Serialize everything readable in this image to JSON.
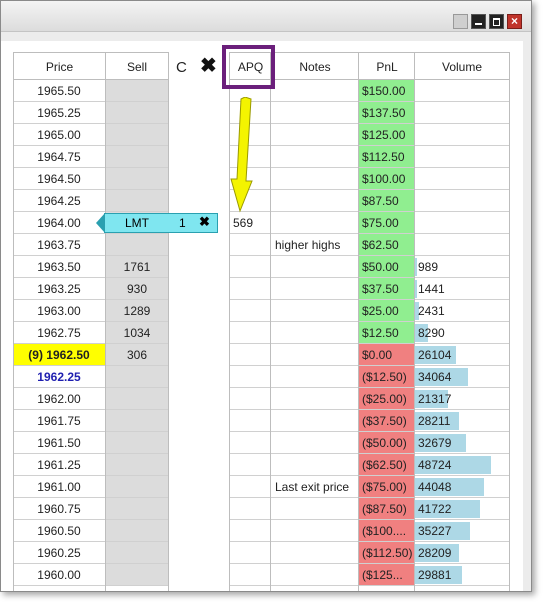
{
  "window": {
    "buttons": {
      "minimize": "minimize",
      "maximize": "maximize",
      "close": "close"
    }
  },
  "header": {
    "price": "Price",
    "sell": "Sell",
    "c": "C",
    "x": "✖",
    "apq": "APQ",
    "notes": "Notes",
    "pnl": "PnL",
    "volume": "Volume"
  },
  "order": {
    "type": "LMT",
    "qty": "1",
    "cancel": "✖"
  },
  "colors": {
    "pnl_positive": "#90ee90",
    "pnl_negative": "#f08080",
    "current_price": "#ffff00",
    "volume_bar": "#add8e6",
    "annotation": "#6b1f7b",
    "arrow": "#f4f400"
  },
  "max_volume": 48724,
  "rows": [
    {
      "price": "1965.50",
      "sell": "",
      "apq": "",
      "notes": "",
      "pnl": "$150.00",
      "pnl_sign": "pos",
      "volume": ""
    },
    {
      "price": "1965.25",
      "sell": "",
      "apq": "",
      "notes": "",
      "pnl": "$137.50",
      "pnl_sign": "pos",
      "volume": ""
    },
    {
      "price": "1965.00",
      "sell": "",
      "apq": "",
      "notes": "",
      "pnl": "$125.00",
      "pnl_sign": "pos",
      "volume": ""
    },
    {
      "price": "1964.75",
      "sell": "",
      "apq": "",
      "notes": "",
      "pnl": "$112.50",
      "pnl_sign": "pos",
      "volume": ""
    },
    {
      "price": "1964.50",
      "sell": "",
      "apq": "",
      "notes": "",
      "pnl": "$100.00",
      "pnl_sign": "pos",
      "volume": ""
    },
    {
      "price": "1964.25",
      "sell": "",
      "apq": "",
      "notes": "",
      "pnl": "$87.50",
      "pnl_sign": "pos",
      "volume": ""
    },
    {
      "price": "1964.00",
      "sell": "",
      "apq": "569",
      "notes": "",
      "pnl": "$75.00",
      "pnl_sign": "pos",
      "volume": ""
    },
    {
      "price": "1963.75",
      "sell": "",
      "apq": "",
      "notes": "higher highs",
      "pnl": "$62.50",
      "pnl_sign": "pos",
      "volume": ""
    },
    {
      "price": "1963.50",
      "sell": "1761",
      "apq": "",
      "notes": "",
      "pnl": "$50.00",
      "pnl_sign": "pos",
      "volume": "989"
    },
    {
      "price": "1963.25",
      "sell": "930",
      "apq": "",
      "notes": "",
      "pnl": "$37.50",
      "pnl_sign": "pos",
      "volume": "1441"
    },
    {
      "price": "1963.00",
      "sell": "1289",
      "apq": "",
      "notes": "",
      "pnl": "$25.00",
      "pnl_sign": "pos",
      "volume": "2431"
    },
    {
      "price": "1962.75",
      "sell": "1034",
      "apq": "",
      "notes": "",
      "pnl": "$12.50",
      "pnl_sign": "pos",
      "volume": "8290"
    },
    {
      "price": "(9) 1962.50",
      "sell": "306",
      "apq": "",
      "notes": "",
      "pnl": "$0.00",
      "pnl_sign": "neg",
      "volume": "26104",
      "current": true
    },
    {
      "price": "1962.25",
      "sell": "",
      "apq": "",
      "notes": "",
      "pnl": "($12.50)",
      "pnl_sign": "neg",
      "volume": "34064",
      "blue": true
    },
    {
      "price": "1962.00",
      "sell": "",
      "apq": "",
      "notes": "",
      "pnl": "($25.00)",
      "pnl_sign": "neg",
      "volume": "21317"
    },
    {
      "price": "1961.75",
      "sell": "",
      "apq": "",
      "notes": "",
      "pnl": "($37.50)",
      "pnl_sign": "neg",
      "volume": "28211"
    },
    {
      "price": "1961.50",
      "sell": "",
      "apq": "",
      "notes": "",
      "pnl": "($50.00)",
      "pnl_sign": "neg",
      "volume": "32679"
    },
    {
      "price": "1961.25",
      "sell": "",
      "apq": "",
      "notes": "",
      "pnl": "($62.50)",
      "pnl_sign": "neg",
      "volume": "48724"
    },
    {
      "price": "1961.00",
      "sell": "",
      "apq": "",
      "notes": "Last exit price",
      "pnl": "($75.00)",
      "pnl_sign": "neg",
      "volume": "44048"
    },
    {
      "price": "1960.75",
      "sell": "",
      "apq": "",
      "notes": "",
      "pnl": "($87.50)",
      "pnl_sign": "neg",
      "volume": "41722"
    },
    {
      "price": "1960.50",
      "sell": "",
      "apq": "",
      "notes": "",
      "pnl": "($100....",
      "pnl_sign": "neg",
      "volume": "35227"
    },
    {
      "price": "1960.25",
      "sell": "",
      "apq": "",
      "notes": "",
      "pnl": "($112.50)",
      "pnl_sign": "neg",
      "volume": "28209"
    },
    {
      "price": "1960.00",
      "sell": "",
      "apq": "",
      "notes": "",
      "pnl": "($125...",
      "pnl_sign": "neg",
      "volume": "29881"
    }
  ]
}
